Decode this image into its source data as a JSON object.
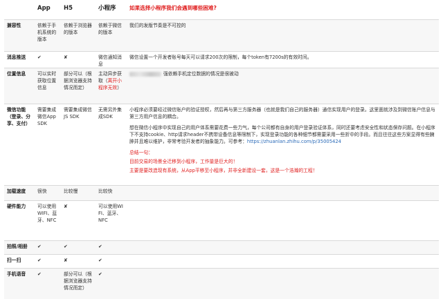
{
  "header": {
    "col0": "",
    "col1": "App",
    "col2": "H5",
    "col3": "小程序",
    "col4": "如果选择小程序我们会遇到哪些困难?"
  },
  "rows": [
    {
      "label": "兼容性",
      "app": "依赖于手机系统的版本",
      "h5": "依赖于浏览器的版本",
      "mp": "依赖于微信的版本",
      "note": "我们的发版节奏是不可控的"
    },
    {
      "label": "消息推送",
      "app": "✔",
      "h5": "✘",
      "mp": "微信通知消息",
      "note": "微信设置一个开发者账号每天可以请求200次的限制，每个token有7200s的有效时间。"
    },
    {
      "label": "位置信息",
      "app": "可以实时获取位置信息",
      "h5": "部分可以（根据浏览器支持情况而定）",
      "mp_main": "主动异步获取（",
      "mp_red": "离开小程序无效",
      "mp_end": "）",
      "note": "强依赖手机定位数据的情况是很被动"
    },
    {
      "label": "微信功能（登录、分享、支付）",
      "app": "需要集成微信App SDK",
      "h5": "需要集成微信JS SDK",
      "mp": "无需另外集成SDK",
      "note_p1": "小程序必须要经过微信账户的验证授权，然后再与第三方服务器（也就是我们自己的服务器）通信实现用户的登录。这里面就涉及到微信账户信息与第三方用户信息的耦合。",
      "note_p2": "想在微信小程序中实现自己的用户体系需要花费一些力气，每个公司都有自身的用户登录验证体系，同时还要考虑安全性和状态保存问题。在小程序下不支持cookie、http请求header不携带设备信息等限制下，实现登录功能的各种细节都需要采用一些折中的手段。而且往往这些方案显得有些臃肿并且难以维护，非常考验开发者的抽象能力。可参考：",
      "note_link": "https://zhuanlan.zhihu.com/p/35005424",
      "summary_title": "总结一句：",
      "summary_1": "目前交易的场景全迁移到小程序，工作量是巨大的！",
      "summary_2": "主要是要改造现有系统，从App平移至小程序，并非全新建设一套，这是一个浩瀚的工程！"
    },
    {
      "label": "加载速度",
      "app": "很快",
      "h5": "比较慢",
      "mp": "比较快",
      "note": ""
    },
    {
      "label": "硬件能力",
      "app": "可以使用WIFI、蓝牙、NFC",
      "h5": "✘",
      "mp": "可以使用WIFI、蓝牙、NFC",
      "note": ""
    },
    {
      "label": "拍照/相册",
      "app": "✔",
      "h5": "✔",
      "mp": "✔",
      "note": ""
    },
    {
      "label": "扫一扫",
      "app": "✔",
      "h5": "✘",
      "mp": "✔",
      "note": ""
    },
    {
      "label": "手机语音",
      "app": "✔",
      "h5": "部分可以（根据浏览器支持情况而定）",
      "mp": "✔",
      "note": ""
    }
  ],
  "colors": {
    "accent_red": "#e02020",
    "link_blue": "#2a6ab8",
    "row_shade": "#f7f7f7",
    "border": "#d9d9d9"
  }
}
